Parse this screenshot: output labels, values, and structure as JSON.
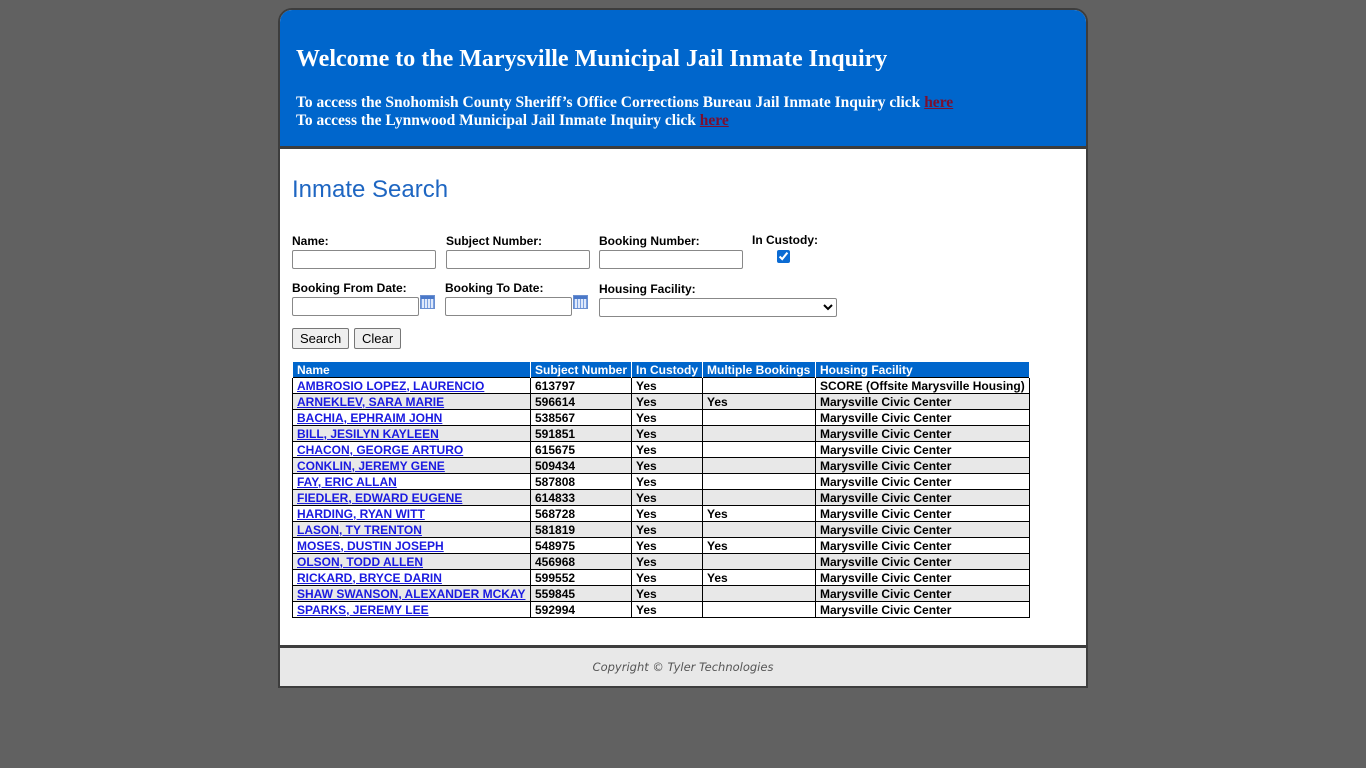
{
  "header": {
    "title": "Welcome to the Marysville Municipal Jail Inmate Inquiry",
    "line1_text": "To access the Snohomish County Sheriff’s Office Corrections Bureau Jail Inmate Inquiry click ",
    "line1_link": "here",
    "line2_text": "To access the Lynnwood Municipal Jail Inmate Inquiry click ",
    "line2_link": "here"
  },
  "search": {
    "title": "Inmate Search",
    "name_label": "Name:",
    "name_value": "",
    "subject_label": "Subject Number:",
    "subject_value": "",
    "booking_label": "Booking Number:",
    "booking_value": "",
    "custody_label": "In Custody:",
    "custody_checked": true,
    "from_label": "Booking From Date:",
    "from_value": "",
    "to_label": "Booking To Date:",
    "to_value": "",
    "facility_label": "Housing Facility:",
    "facility_selected": "",
    "search_button": "Search",
    "clear_button": "Clear"
  },
  "results": {
    "columns": [
      "Name",
      "Subject Number",
      "In Custody",
      "Multiple Bookings",
      "Housing Facility"
    ],
    "rows": [
      {
        "name": "AMBROSIO LOPEZ, LAURENCIO",
        "subject": "613797",
        "custody": "Yes",
        "multiple": "",
        "facility": "SCORE (Offsite Marysville Housing)"
      },
      {
        "name": "ARNEKLEV, SARA MARIE",
        "subject": "596614",
        "custody": "Yes",
        "multiple": "Yes",
        "facility": "Marysville Civic Center"
      },
      {
        "name": "BACHIA, EPHRAIM JOHN",
        "subject": "538567",
        "custody": "Yes",
        "multiple": "",
        "facility": "Marysville Civic Center"
      },
      {
        "name": "BILL, JESILYN KAYLEEN",
        "subject": "591851",
        "custody": "Yes",
        "multiple": "",
        "facility": "Marysville Civic Center"
      },
      {
        "name": "CHACON, GEORGE ARTURO",
        "subject": "615675",
        "custody": "Yes",
        "multiple": "",
        "facility": "Marysville Civic Center"
      },
      {
        "name": "CONKLIN, JEREMY GENE",
        "subject": "509434",
        "custody": "Yes",
        "multiple": "",
        "facility": "Marysville Civic Center"
      },
      {
        "name": "FAY, ERIC ALLAN",
        "subject": "587808",
        "custody": "Yes",
        "multiple": "",
        "facility": "Marysville Civic Center"
      },
      {
        "name": "FIEDLER, EDWARD EUGENE",
        "subject": "614833",
        "custody": "Yes",
        "multiple": "",
        "facility": "Marysville Civic Center"
      },
      {
        "name": "HARDING, RYAN WITT",
        "subject": "568728",
        "custody": "Yes",
        "multiple": "Yes",
        "facility": "Marysville Civic Center"
      },
      {
        "name": "LASON, TY TRENTON",
        "subject": "581819",
        "custody": "Yes",
        "multiple": "",
        "facility": "Marysville Civic Center"
      },
      {
        "name": "MOSES, DUSTIN JOSEPH",
        "subject": "548975",
        "custody": "Yes",
        "multiple": "Yes",
        "facility": "Marysville Civic Center"
      },
      {
        "name": "OLSON, TODD ALLEN",
        "subject": "456968",
        "custody": "Yes",
        "multiple": "",
        "facility": "Marysville Civic Center"
      },
      {
        "name": "RICKARD, BRYCE DARIN",
        "subject": "599552",
        "custody": "Yes",
        "multiple": "Yes",
        "facility": "Marysville Civic Center"
      },
      {
        "name": "SHAW SWANSON, ALEXANDER MCKAY",
        "subject": "559845",
        "custody": "Yes",
        "multiple": "",
        "facility": "Marysville Civic Center"
      },
      {
        "name": "SPARKS, JEREMY LEE",
        "subject": "592994",
        "custody": "Yes",
        "multiple": "",
        "facility": "Marysville Civic Center"
      }
    ]
  },
  "footer": {
    "copyright": "Copyright © Tyler Technologies"
  }
}
